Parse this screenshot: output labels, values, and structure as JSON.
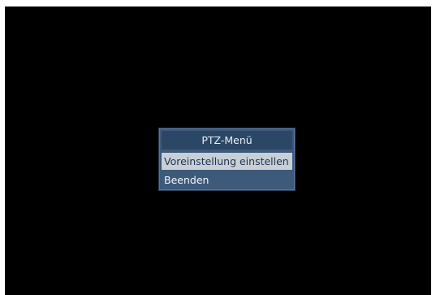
{
  "menu": {
    "title": "PTZ-Menü",
    "items": [
      {
        "label": "Voreinstellung einstellen",
        "selected": true
      },
      {
        "label": "Beenden",
        "selected": false
      }
    ]
  },
  "colors": {
    "screen_background": "#000000",
    "menu_panel": "#3d5a7a",
    "menu_title_bar": "#2c4766",
    "selected_item_background": "#c8cfd6",
    "selected_item_text": "#1e3452",
    "item_text": "#f2f6fa"
  }
}
